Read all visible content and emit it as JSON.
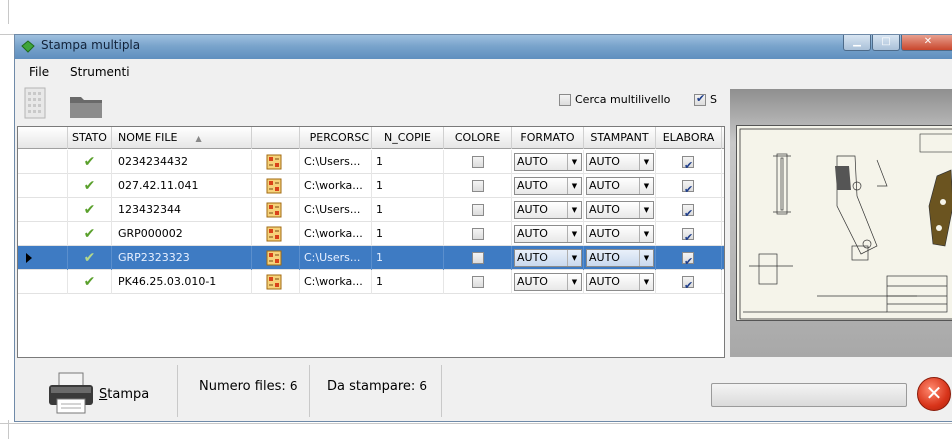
{
  "window": {
    "title": "Stampa multipla"
  },
  "menu": {
    "file": "File",
    "tools": "Strumenti"
  },
  "toolbar": {
    "options": [
      {
        "label": "Cerca multilivello",
        "checked": false
      },
      {
        "label": "S",
        "checked": true
      }
    ]
  },
  "grid": {
    "columns": [
      "STATO",
      "NOME FILE",
      "PERCORSO",
      "N_COPIE",
      "COLORE",
      "FORMATO",
      "STAMPANT",
      "ELABORA"
    ],
    "column_display": [
      "STATO",
      "NOME FILE",
      "PERCORSC",
      "N_COPIE",
      "COLORE",
      "FORMATO",
      "STAMPANT",
      "ELABORA"
    ],
    "rows": [
      {
        "stato": "ok",
        "nome_file": "0234234432",
        "percorso": "C:\\Users...",
        "n_copie": "1",
        "colore": false,
        "formato": "AUTO",
        "stampante": "AUTO",
        "elabora": true,
        "selected": false
      },
      {
        "stato": "ok",
        "nome_file": "027.42.11.041",
        "percorso": "C:\\worka...",
        "n_copie": "1",
        "colore": false,
        "formato": "AUTO",
        "stampante": "AUTO",
        "elabora": true,
        "selected": false
      },
      {
        "stato": "ok",
        "nome_file": "123432344",
        "percorso": "C:\\Users...",
        "n_copie": "1",
        "colore": false,
        "formato": "AUTO",
        "stampante": "AUTO",
        "elabora": true,
        "selected": false
      },
      {
        "stato": "ok",
        "nome_file": "GRP000002",
        "percorso": "C:\\worka...",
        "n_copie": "1",
        "colore": false,
        "formato": "AUTO",
        "stampante": "AUTO",
        "elabora": true,
        "selected": false
      },
      {
        "stato": "ok",
        "nome_file": "GRP2323323",
        "percorso": "C:\\Users...",
        "n_copie": "1",
        "colore": false,
        "formato": "AUTO",
        "stampante": "AUTO",
        "elabora": true,
        "selected": true
      },
      {
        "stato": "ok",
        "nome_file": "PK46.25.03.010-1",
        "percorso": "C:\\worka...",
        "n_copie": "1",
        "colore": false,
        "formato": "AUTO",
        "stampante": "AUTO",
        "elabora": true,
        "selected": false
      }
    ]
  },
  "status": {
    "print_label": "Stampa",
    "print_underline": "S",
    "print_rest": "tampa",
    "files_label": "Numero files:",
    "files_count": "6",
    "to_print_label": "Da stampare:",
    "to_print_count": "6",
    "progress": 0
  },
  "colors": {
    "accent": "#3e7bc3",
    "check": "#5aa02c",
    "cancel": "#d8341a"
  }
}
